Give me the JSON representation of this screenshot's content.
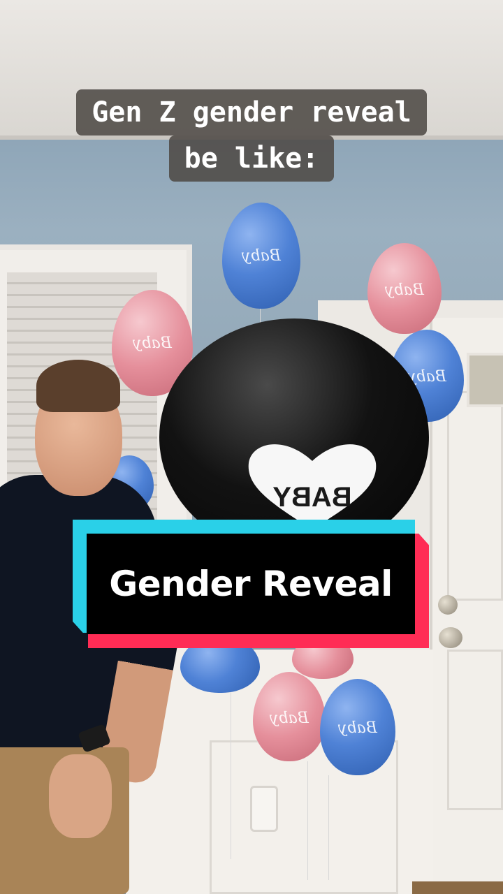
{
  "caption": {
    "line1": "Gen Z gender reveal",
    "line2": "be like:"
  },
  "sticker": {
    "text": "Gender Reveal"
  },
  "scene": {
    "big_balloon_text": "BABY",
    "small_balloon_text": "Baby"
  },
  "colors": {
    "sticker_cyan": "#2ad0e8",
    "sticker_red": "#ff2c55",
    "sticker_black": "#000000"
  }
}
